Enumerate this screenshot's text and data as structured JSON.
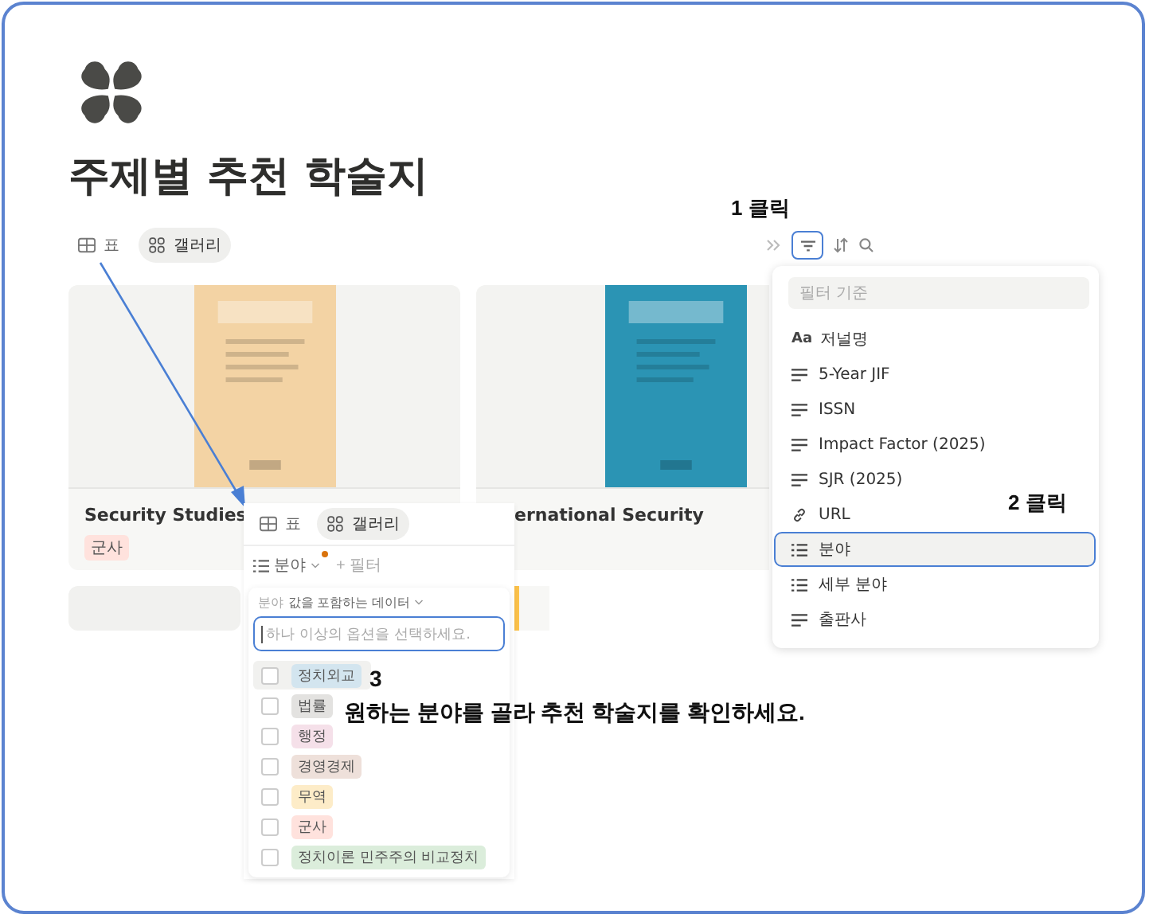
{
  "page": {
    "title": "주제별 추천 학술지"
  },
  "views": [
    {
      "label": "표",
      "kind": "table",
      "selected": false
    },
    {
      "label": "갤러리",
      "kind": "gallery",
      "selected": true
    }
  ],
  "cards": [
    {
      "title": "Security Studies",
      "tag": {
        "label": "군사",
        "color": "#ffe2dd"
      }
    },
    {
      "title": "ernational Security"
    }
  ],
  "filter_menu": {
    "placeholder": "필터 기준",
    "items": [
      {
        "kind": "title",
        "glyph": "Aa",
        "label": "저널명",
        "selected": false
      },
      {
        "kind": "text",
        "label": "5-Year JIF",
        "selected": false
      },
      {
        "kind": "text",
        "label": "ISSN",
        "selected": false
      },
      {
        "kind": "text",
        "label": "Impact Factor (2025)",
        "selected": false
      },
      {
        "kind": "text",
        "label": "SJR (2025)",
        "selected": false
      },
      {
        "kind": "url",
        "label": "URL",
        "selected": false
      },
      {
        "kind": "select",
        "label": "분야",
        "selected": true
      },
      {
        "kind": "select",
        "label": "세부 분야",
        "selected": false
      },
      {
        "kind": "text",
        "label": "출판사",
        "selected": false
      }
    ]
  },
  "inset": {
    "views": [
      {
        "label": "표",
        "kind": "table",
        "selected": false
      },
      {
        "label": "갤러리",
        "kind": "gallery",
        "selected": true
      }
    ],
    "filter_chip": {
      "label": "분야",
      "changed": true
    },
    "add_filter": "+ 필터",
    "condition": {
      "property": "분야",
      "operator": "값을 포함하는 데이터"
    },
    "input_placeholder": "하나 이상의 옵션을 선택하세요.",
    "options": [
      {
        "label": "정치외교",
        "color": "#d3e5ef",
        "checked": false,
        "hovered": true
      },
      {
        "label": "법률",
        "color": "#e3e2e0",
        "checked": false,
        "hovered": false
      },
      {
        "label": "행정",
        "color": "#f5e0e9",
        "checked": false,
        "hovered": false
      },
      {
        "label": "경영경제",
        "color": "#eee0da",
        "checked": false,
        "hovered": false
      },
      {
        "label": "무역",
        "color": "#fdecc8",
        "checked": false,
        "hovered": false
      },
      {
        "label": "군사",
        "color": "#ffe2dd",
        "checked": false,
        "hovered": false
      },
      {
        "label": "정치이론 민주주의 비교정치",
        "color": "#dbeddb",
        "checked": false,
        "hovered": false
      }
    ]
  },
  "annotations": {
    "step1": "1  클릭",
    "step2": "2  클릭",
    "step3": "3",
    "instruction": "원하는 분야를 골라 추천 학술지를 확인하세요."
  }
}
